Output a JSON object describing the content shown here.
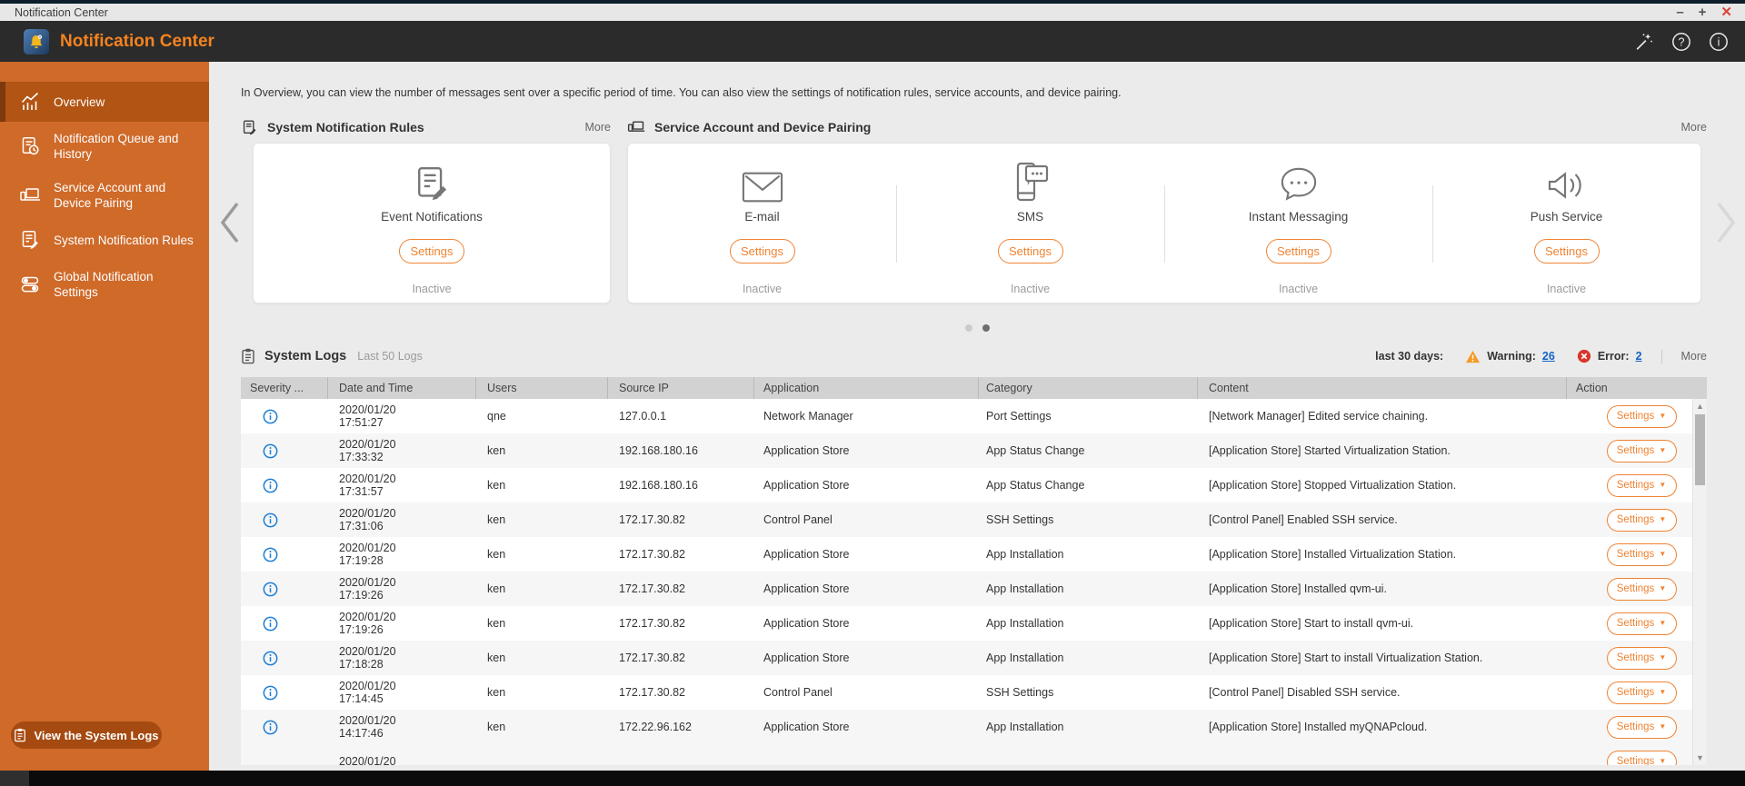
{
  "window": {
    "title": "Notification Center",
    "minimize": "–",
    "maximize": "+",
    "close": "✕"
  },
  "app_header": {
    "title": "Notification Center"
  },
  "sidebar": {
    "items": [
      {
        "label": "Overview",
        "icon": "chart",
        "selected": true
      },
      {
        "label": "Notification Queue and History",
        "icon": "queue-history"
      },
      {
        "label": "Service Account and Device Pairing",
        "icon": "device-pairing"
      },
      {
        "label": "System Notification Rules",
        "icon": "rules"
      },
      {
        "label": "Global Notification Settings",
        "icon": "global-settings"
      }
    ],
    "footer_button": "View the System Logs"
  },
  "overview": {
    "description": "In Overview, you can view the number of messages sent over a specific period of time. You can also view the settings of notification rules, service accounts, and device pairing.",
    "rules_panel": {
      "title": "System Notification Rules",
      "more": "More",
      "card": {
        "label": "Event Notifications",
        "button": "Settings",
        "status": "Inactive"
      }
    },
    "services_panel": {
      "title": "Service Account and Device Pairing",
      "more": "More",
      "cards": [
        {
          "label": "E-mail",
          "icon": "email",
          "button": "Settings",
          "status": "Inactive"
        },
        {
          "label": "SMS",
          "icon": "sms",
          "button": "Settings",
          "status": "Inactive"
        },
        {
          "label": "Instant Messaging",
          "icon": "instant-messaging",
          "button": "Settings",
          "status": "Inactive"
        },
        {
          "label": "Push Service",
          "icon": "push-service",
          "button": "Settings",
          "status": "Inactive"
        }
      ]
    },
    "carousel": {
      "page_count": 2,
      "active_page": 2
    }
  },
  "system_logs": {
    "title": "System Logs",
    "subtitle": "Last 50 Logs",
    "summary": {
      "period_label": "last 30 days:",
      "warning_label": "Warning:",
      "warning_count": "26",
      "error_label": "Error:",
      "error_count": "2",
      "more": "More"
    },
    "table": {
      "columns": [
        "Severity ...",
        "Date and Time",
        "Users",
        "Source IP",
        "Application",
        "Category",
        "Content",
        "Action"
      ],
      "action_button": "Settings",
      "rows": [
        {
          "severity": "info",
          "date": "2020/01/20",
          "time": "17:51:27",
          "user": "qne",
          "source_ip": "127.0.0.1",
          "application": "Network Manager",
          "category": "Port Settings",
          "content": "[Network Manager] Edited service chaining."
        },
        {
          "severity": "info",
          "date": "2020/01/20",
          "time": "17:33:32",
          "user": "ken",
          "source_ip": "192.168.180.16",
          "application": "Application Store",
          "category": "App Status Change",
          "content": "[Application Store] Started Virtualization Station."
        },
        {
          "severity": "info",
          "date": "2020/01/20",
          "time": "17:31:57",
          "user": "ken",
          "source_ip": "192.168.180.16",
          "application": "Application Store",
          "category": "App Status Change",
          "content": "[Application Store] Stopped Virtualization Station."
        },
        {
          "severity": "info",
          "date": "2020/01/20",
          "time": "17:31:06",
          "user": "ken",
          "source_ip": "172.17.30.82",
          "application": "Control Panel",
          "category": "SSH Settings",
          "content": "[Control Panel] Enabled SSH service."
        },
        {
          "severity": "info",
          "date": "2020/01/20",
          "time": "17:19:28",
          "user": "ken",
          "source_ip": "172.17.30.82",
          "application": "Application Store",
          "category": "App Installation",
          "content": "[Application Store] Installed Virtualization Station."
        },
        {
          "severity": "info",
          "date": "2020/01/20",
          "time": "17:19:26",
          "user": "ken",
          "source_ip": "172.17.30.82",
          "application": "Application Store",
          "category": "App Installation",
          "content": "[Application Store] Installed qvm-ui."
        },
        {
          "severity": "info",
          "date": "2020/01/20",
          "time": "17:19:26",
          "user": "ken",
          "source_ip": "172.17.30.82",
          "application": "Application Store",
          "category": "App Installation",
          "content": "[Application Store] Start to install qvm-ui."
        },
        {
          "severity": "info",
          "date": "2020/01/20",
          "time": "17:18:28",
          "user": "ken",
          "source_ip": "172.17.30.82",
          "application": "Application Store",
          "category": "App Installation",
          "content": "[Application Store] Start to install Virtualization Station."
        },
        {
          "severity": "info",
          "date": "2020/01/20",
          "time": "17:14:45",
          "user": "ken",
          "source_ip": "172.17.30.82",
          "application": "Control Panel",
          "category": "SSH Settings",
          "content": "[Control Panel] Disabled SSH service."
        },
        {
          "severity": "info",
          "date": "2020/01/20",
          "time": "14:17:46",
          "user": "ken",
          "source_ip": "172.22.96.162",
          "application": "Application Store",
          "category": "App Installation",
          "content": "[Application Store] Installed myQNAPcloud."
        }
      ],
      "partial_row": {
        "date": "2020/01/20"
      }
    }
  },
  "colors": {
    "accent_orange": "#ef8332",
    "sidebar_orange": "#cf6a29",
    "header_dark": "#2b2b2b",
    "warning": "#f59a23",
    "error": "#d8352a",
    "info_blue": "#1d7fd6",
    "link_blue": "#1464c4"
  }
}
